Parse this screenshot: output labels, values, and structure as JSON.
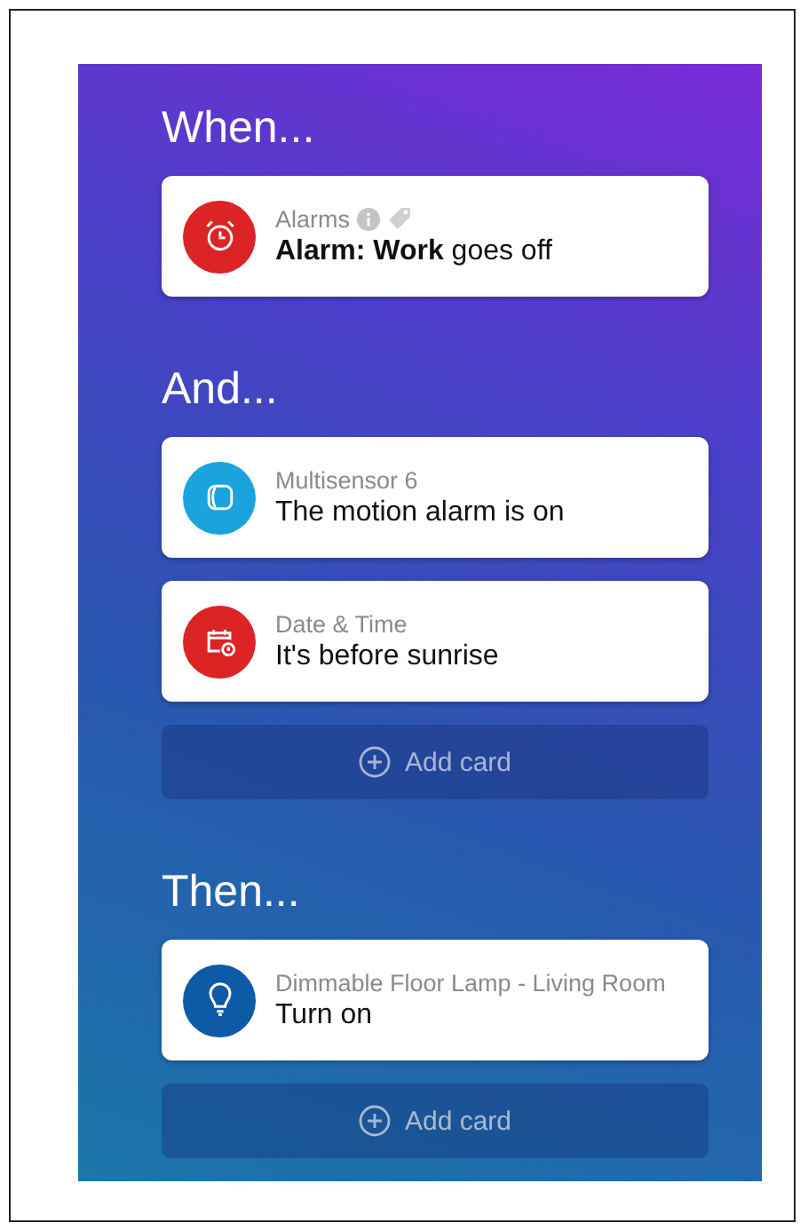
{
  "sections": [
    {
      "heading": "When...",
      "cards": [
        {
          "kind": "alarm",
          "color": "#dc2424",
          "subtitle": "Alarms",
          "badges": true,
          "text": "**Alarm: Work** goes off"
        }
      ]
    },
    {
      "heading": "And...",
      "cards": [
        {
          "kind": "sensor",
          "color": "#1aa3dc",
          "subtitle": "Multisensor 6",
          "badges": false,
          "text": "The motion alarm is on"
        },
        {
          "kind": "calendar",
          "color": "#dc2424",
          "subtitle": "Date & Time",
          "badges": false,
          "text": "It's before sunrise"
        }
      ],
      "add_label": "Add card"
    },
    {
      "heading": "Then...",
      "cards": [
        {
          "kind": "bulb",
          "color": "#0d5aa7",
          "subtitle": "Dimmable Floor Lamp - Living Room",
          "badges": false,
          "text": "Turn on"
        }
      ],
      "add_label": "Add card"
    }
  ]
}
